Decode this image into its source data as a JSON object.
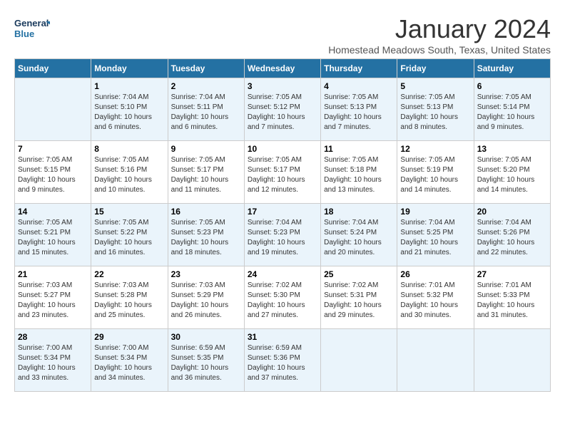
{
  "logo": {
    "line1": "General",
    "line2": "Blue"
  },
  "title": "January 2024",
  "subtitle": "Homestead Meadows South, Texas, United States",
  "headers": [
    "Sunday",
    "Monday",
    "Tuesday",
    "Wednesday",
    "Thursday",
    "Friday",
    "Saturday"
  ],
  "weeks": [
    [
      {
        "day": "",
        "info": ""
      },
      {
        "day": "1",
        "info": "Sunrise: 7:04 AM\nSunset: 5:10 PM\nDaylight: 10 hours\nand 6 minutes."
      },
      {
        "day": "2",
        "info": "Sunrise: 7:04 AM\nSunset: 5:11 PM\nDaylight: 10 hours\nand 6 minutes."
      },
      {
        "day": "3",
        "info": "Sunrise: 7:05 AM\nSunset: 5:12 PM\nDaylight: 10 hours\nand 7 minutes."
      },
      {
        "day": "4",
        "info": "Sunrise: 7:05 AM\nSunset: 5:13 PM\nDaylight: 10 hours\nand 7 minutes."
      },
      {
        "day": "5",
        "info": "Sunrise: 7:05 AM\nSunset: 5:13 PM\nDaylight: 10 hours\nand 8 minutes."
      },
      {
        "day": "6",
        "info": "Sunrise: 7:05 AM\nSunset: 5:14 PM\nDaylight: 10 hours\nand 9 minutes."
      }
    ],
    [
      {
        "day": "7",
        "info": "Sunrise: 7:05 AM\nSunset: 5:15 PM\nDaylight: 10 hours\nand 9 minutes."
      },
      {
        "day": "8",
        "info": "Sunrise: 7:05 AM\nSunset: 5:16 PM\nDaylight: 10 hours\nand 10 minutes."
      },
      {
        "day": "9",
        "info": "Sunrise: 7:05 AM\nSunset: 5:17 PM\nDaylight: 10 hours\nand 11 minutes."
      },
      {
        "day": "10",
        "info": "Sunrise: 7:05 AM\nSunset: 5:17 PM\nDaylight: 10 hours\nand 12 minutes."
      },
      {
        "day": "11",
        "info": "Sunrise: 7:05 AM\nSunset: 5:18 PM\nDaylight: 10 hours\nand 13 minutes."
      },
      {
        "day": "12",
        "info": "Sunrise: 7:05 AM\nSunset: 5:19 PM\nDaylight: 10 hours\nand 14 minutes."
      },
      {
        "day": "13",
        "info": "Sunrise: 7:05 AM\nSunset: 5:20 PM\nDaylight: 10 hours\nand 14 minutes."
      }
    ],
    [
      {
        "day": "14",
        "info": "Sunrise: 7:05 AM\nSunset: 5:21 PM\nDaylight: 10 hours\nand 15 minutes."
      },
      {
        "day": "15",
        "info": "Sunrise: 7:05 AM\nSunset: 5:22 PM\nDaylight: 10 hours\nand 16 minutes."
      },
      {
        "day": "16",
        "info": "Sunrise: 7:05 AM\nSunset: 5:23 PM\nDaylight: 10 hours\nand 18 minutes."
      },
      {
        "day": "17",
        "info": "Sunrise: 7:04 AM\nSunset: 5:23 PM\nDaylight: 10 hours\nand 19 minutes."
      },
      {
        "day": "18",
        "info": "Sunrise: 7:04 AM\nSunset: 5:24 PM\nDaylight: 10 hours\nand 20 minutes."
      },
      {
        "day": "19",
        "info": "Sunrise: 7:04 AM\nSunset: 5:25 PM\nDaylight: 10 hours\nand 21 minutes."
      },
      {
        "day": "20",
        "info": "Sunrise: 7:04 AM\nSunset: 5:26 PM\nDaylight: 10 hours\nand 22 minutes."
      }
    ],
    [
      {
        "day": "21",
        "info": "Sunrise: 7:03 AM\nSunset: 5:27 PM\nDaylight: 10 hours\nand 23 minutes."
      },
      {
        "day": "22",
        "info": "Sunrise: 7:03 AM\nSunset: 5:28 PM\nDaylight: 10 hours\nand 25 minutes."
      },
      {
        "day": "23",
        "info": "Sunrise: 7:03 AM\nSunset: 5:29 PM\nDaylight: 10 hours\nand 26 minutes."
      },
      {
        "day": "24",
        "info": "Sunrise: 7:02 AM\nSunset: 5:30 PM\nDaylight: 10 hours\nand 27 minutes."
      },
      {
        "day": "25",
        "info": "Sunrise: 7:02 AM\nSunset: 5:31 PM\nDaylight: 10 hours\nand 29 minutes."
      },
      {
        "day": "26",
        "info": "Sunrise: 7:01 AM\nSunset: 5:32 PM\nDaylight: 10 hours\nand 30 minutes."
      },
      {
        "day": "27",
        "info": "Sunrise: 7:01 AM\nSunset: 5:33 PM\nDaylight: 10 hours\nand 31 minutes."
      }
    ],
    [
      {
        "day": "28",
        "info": "Sunrise: 7:00 AM\nSunset: 5:34 PM\nDaylight: 10 hours\nand 33 minutes."
      },
      {
        "day": "29",
        "info": "Sunrise: 7:00 AM\nSunset: 5:34 PM\nDaylight: 10 hours\nand 34 minutes."
      },
      {
        "day": "30",
        "info": "Sunrise: 6:59 AM\nSunset: 5:35 PM\nDaylight: 10 hours\nand 36 minutes."
      },
      {
        "day": "31",
        "info": "Sunrise: 6:59 AM\nSunset: 5:36 PM\nDaylight: 10 hours\nand 37 minutes."
      },
      {
        "day": "",
        "info": ""
      },
      {
        "day": "",
        "info": ""
      },
      {
        "day": "",
        "info": ""
      }
    ]
  ]
}
